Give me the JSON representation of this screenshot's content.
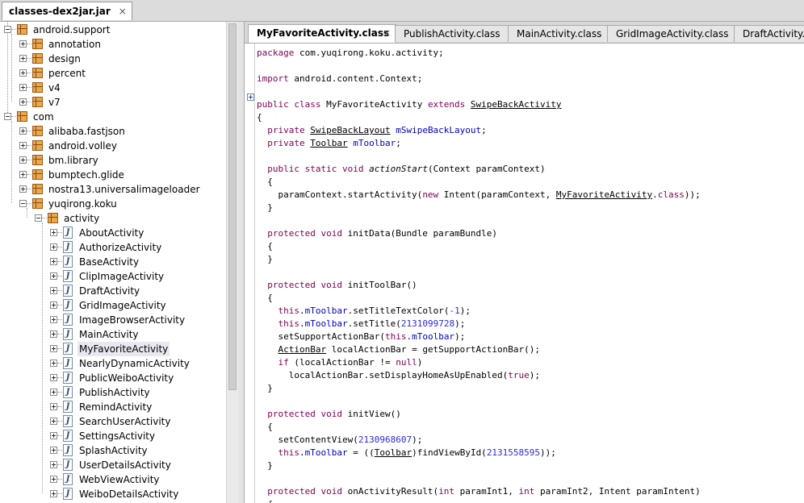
{
  "file_tab": {
    "label": "classes-dex2jar.jar",
    "close": "×"
  },
  "tree": [
    {
      "label": "android.support",
      "type": "package",
      "depth": 0,
      "toggle": "minus"
    },
    {
      "label": "annotation",
      "type": "package",
      "depth": 1,
      "toggle": "plus"
    },
    {
      "label": "design",
      "type": "package",
      "depth": 1,
      "toggle": "plus"
    },
    {
      "label": "percent",
      "type": "package",
      "depth": 1,
      "toggle": "plus"
    },
    {
      "label": "v4",
      "type": "package",
      "depth": 1,
      "toggle": "plus"
    },
    {
      "label": "v7",
      "type": "package",
      "depth": 1,
      "toggle": "plus"
    },
    {
      "label": "com",
      "type": "package",
      "depth": 0,
      "toggle": "minus"
    },
    {
      "label": "alibaba.fastjson",
      "type": "package",
      "depth": 1,
      "toggle": "plus"
    },
    {
      "label": "android.volley",
      "type": "package",
      "depth": 1,
      "toggle": "plus"
    },
    {
      "label": "bm.library",
      "type": "package",
      "depth": 1,
      "toggle": "plus"
    },
    {
      "label": "bumptech.glide",
      "type": "package",
      "depth": 1,
      "toggle": "plus"
    },
    {
      "label": "nostra13.universalimageloader",
      "type": "package",
      "depth": 1,
      "toggle": "plus"
    },
    {
      "label": "yuqirong.koku",
      "type": "package",
      "depth": 1,
      "toggle": "minus"
    },
    {
      "label": "activity",
      "type": "package",
      "depth": 2,
      "toggle": "minus"
    },
    {
      "label": "AboutActivity",
      "type": "class",
      "depth": 3,
      "toggle": "plus"
    },
    {
      "label": "AuthorizeActivity",
      "type": "class",
      "depth": 3,
      "toggle": "plus"
    },
    {
      "label": "BaseActivity",
      "type": "class",
      "depth": 3,
      "toggle": "plus"
    },
    {
      "label": "ClipImageActivity",
      "type": "class",
      "depth": 3,
      "toggle": "plus"
    },
    {
      "label": "DraftActivity",
      "type": "class",
      "depth": 3,
      "toggle": "plus"
    },
    {
      "label": "GridImageActivity",
      "type": "class",
      "depth": 3,
      "toggle": "plus"
    },
    {
      "label": "ImageBrowserActivity",
      "type": "class",
      "depth": 3,
      "toggle": "plus"
    },
    {
      "label": "MainActivity",
      "type": "class",
      "depth": 3,
      "toggle": "plus"
    },
    {
      "label": "MyFavoriteActivity",
      "type": "class",
      "depth": 3,
      "toggle": "plus",
      "selected": true
    },
    {
      "label": "NearlyDynamicActivity",
      "type": "class",
      "depth": 3,
      "toggle": "plus"
    },
    {
      "label": "PublicWeiboActivity",
      "type": "class",
      "depth": 3,
      "toggle": "plus"
    },
    {
      "label": "PublishActivity",
      "type": "class",
      "depth": 3,
      "toggle": "plus"
    },
    {
      "label": "RemindActivity",
      "type": "class",
      "depth": 3,
      "toggle": "plus"
    },
    {
      "label": "SearchUserActivity",
      "type": "class",
      "depth": 3,
      "toggle": "plus"
    },
    {
      "label": "SettingsActivity",
      "type": "class",
      "depth": 3,
      "toggle": "plus"
    },
    {
      "label": "SplashActivity",
      "type": "class",
      "depth": 3,
      "toggle": "plus"
    },
    {
      "label": "UserDetailsActivity",
      "type": "class",
      "depth": 3,
      "toggle": "plus"
    },
    {
      "label": "WebViewActivity",
      "type": "class",
      "depth": 3,
      "toggle": "plus"
    },
    {
      "label": "WeiboDetailsActivity",
      "type": "class",
      "depth": 3,
      "toggle": "plus"
    }
  ],
  "editor_tabs": [
    {
      "label": "MyFavoriteActivity.class",
      "active": true,
      "close": "×"
    },
    {
      "label": "PublishActivity.class",
      "active": false
    },
    {
      "label": "MainActivity.class",
      "active": false
    },
    {
      "label": "GridImageActivity.class",
      "active": false
    },
    {
      "label": "DraftActivity.cl",
      "active": false
    }
  ],
  "code_lines": [
    [
      [
        "package",
        "kw"
      ],
      [
        " com.yuqirong.koku.activity;",
        ""
      ]
    ],
    [],
    [
      [
        "import",
        "kw"
      ],
      [
        " android.content.Context;",
        ""
      ]
    ],
    [],
    [
      [
        "public class",
        "kw"
      ],
      [
        " MyFavoriteActivity ",
        ""
      ],
      [
        "extends",
        "kw"
      ],
      [
        " ",
        ""
      ],
      [
        "SwipeBackActivity",
        "ul"
      ]
    ],
    [
      [
        "{",
        ""
      ]
    ],
    [
      [
        "  ",
        ""
      ],
      [
        "private",
        "kw"
      ],
      [
        " ",
        ""
      ],
      [
        "SwipeBackLayout",
        "ul"
      ],
      [
        " ",
        ""
      ],
      [
        "mSwipeBackLayout",
        "fld"
      ],
      [
        ";",
        ""
      ]
    ],
    [
      [
        "  ",
        ""
      ],
      [
        "private",
        "kw"
      ],
      [
        " ",
        ""
      ],
      [
        "Toolbar",
        "ul"
      ],
      [
        " ",
        ""
      ],
      [
        "mToolbar",
        "fld"
      ],
      [
        ";",
        ""
      ]
    ],
    [],
    [
      [
        "  ",
        ""
      ],
      [
        "public static void",
        "kw"
      ],
      [
        " ",
        ""
      ],
      [
        "actionStart",
        "it"
      ],
      [
        "(Context paramContext)",
        ""
      ]
    ],
    [
      [
        "  {",
        ""
      ]
    ],
    [
      [
        "    paramContext.startActivity(",
        ""
      ],
      [
        "new",
        "kw"
      ],
      [
        " Intent(paramContext, ",
        ""
      ],
      [
        "MyFavoriteActivity",
        "ul"
      ],
      [
        ".",
        ""
      ],
      [
        "class",
        "kw"
      ],
      [
        "));",
        ""
      ]
    ],
    [
      [
        "  }",
        ""
      ]
    ],
    [],
    [
      [
        "  ",
        ""
      ],
      [
        "protected void",
        "kw"
      ],
      [
        " initData(Bundle paramBundle)",
        ""
      ]
    ],
    [
      [
        "  {",
        ""
      ]
    ],
    [
      [
        "  }",
        ""
      ]
    ],
    [],
    [
      [
        "  ",
        ""
      ],
      [
        "protected void",
        "kw"
      ],
      [
        " initToolBar()",
        ""
      ]
    ],
    [
      [
        "  {",
        ""
      ]
    ],
    [
      [
        "    ",
        ""
      ],
      [
        "this",
        "kw"
      ],
      [
        ".",
        ""
      ],
      [
        "mToolbar",
        "fld"
      ],
      [
        ".setTitleTextColor(",
        ""
      ],
      [
        "-1",
        "num"
      ],
      [
        ");",
        ""
      ]
    ],
    [
      [
        "    ",
        ""
      ],
      [
        "this",
        "kw"
      ],
      [
        ".",
        ""
      ],
      [
        "mToolbar",
        "fld"
      ],
      [
        ".setTitle(",
        ""
      ],
      [
        "2131099728",
        "num"
      ],
      [
        ");",
        ""
      ]
    ],
    [
      [
        "    setSupportActionBar(",
        ""
      ],
      [
        "this",
        "kw"
      ],
      [
        ".",
        ""
      ],
      [
        "mToolbar",
        "fld"
      ],
      [
        ");",
        ""
      ]
    ],
    [
      [
        "    ",
        ""
      ],
      [
        "ActionBar",
        "ul"
      ],
      [
        " localActionBar = getSupportActionBar();",
        ""
      ]
    ],
    [
      [
        "    ",
        ""
      ],
      [
        "if",
        "kw"
      ],
      [
        " (localActionBar != ",
        ""
      ],
      [
        "null",
        "kw"
      ],
      [
        ")",
        ""
      ]
    ],
    [
      [
        "      localActionBar.setDisplayHomeAsUpEnabled(",
        ""
      ],
      [
        "true",
        "kw"
      ],
      [
        ");",
        ""
      ]
    ],
    [
      [
        "  }",
        ""
      ]
    ],
    [],
    [
      [
        "  ",
        ""
      ],
      [
        "protected void",
        "kw"
      ],
      [
        " initView()",
        ""
      ]
    ],
    [
      [
        "  {",
        ""
      ]
    ],
    [
      [
        "    setContentView(",
        ""
      ],
      [
        "2130968607",
        "num"
      ],
      [
        ");",
        ""
      ]
    ],
    [
      [
        "    ",
        ""
      ],
      [
        "this",
        "kw"
      ],
      [
        ".",
        ""
      ],
      [
        "mToolbar",
        "fld"
      ],
      [
        " = ((",
        ""
      ],
      [
        "Toolbar",
        "ul"
      ],
      [
        ")findViewById(",
        ""
      ],
      [
        "2131558595",
        "num"
      ],
      [
        "));",
        ""
      ]
    ],
    [
      [
        "  }",
        ""
      ]
    ],
    [],
    [
      [
        "  ",
        ""
      ],
      [
        "protected void",
        "kw"
      ],
      [
        " onActivityResult(",
        ""
      ],
      [
        "int",
        "kw"
      ],
      [
        " paramInt1, ",
        ""
      ],
      [
        "int",
        "kw"
      ],
      [
        " paramInt2, Intent paramIntent)",
        ""
      ]
    ],
    [
      [
        "  {",
        ""
      ]
    ]
  ]
}
